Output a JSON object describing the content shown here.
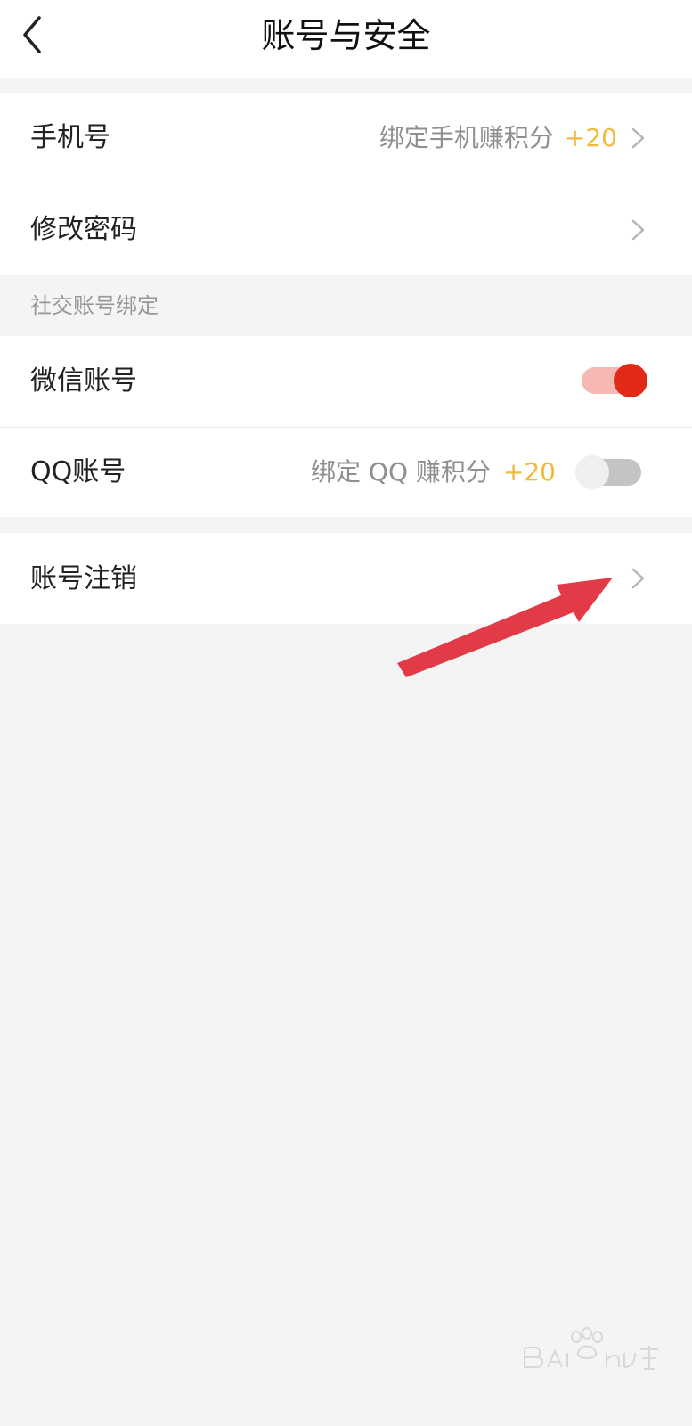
{
  "header": {
    "title": "账号与安全"
  },
  "rows": {
    "phone": {
      "label": "手机号",
      "hint": "绑定手机赚积分",
      "bonus": "+20"
    },
    "password": {
      "label": "修改密码"
    },
    "social_section": {
      "label": "社交账号绑定"
    },
    "wechat": {
      "label": "微信账号",
      "toggle_on": true
    },
    "qq": {
      "label": "QQ账号",
      "hint": "绑定 QQ 赚积分",
      "bonus": "+20",
      "toggle_on": false
    },
    "deactivate": {
      "label": "账号注销"
    }
  },
  "colors": {
    "background": "#f4f4f5",
    "accent_red": "#e02a16",
    "toggle_on_track": "#f5b8b2",
    "toggle_off_track": "#c4c4c4",
    "toggle_off_knob": "#efefef",
    "bonus_yellow": "#f0bb3c",
    "annotation_arrow": "#e33a48"
  },
  "icons": {
    "back": "chevron-left-icon",
    "row_arrow": "chevron-right-icon",
    "annotation": "red-arrow-icon",
    "watermark": "baidu-jingyan-watermark"
  }
}
